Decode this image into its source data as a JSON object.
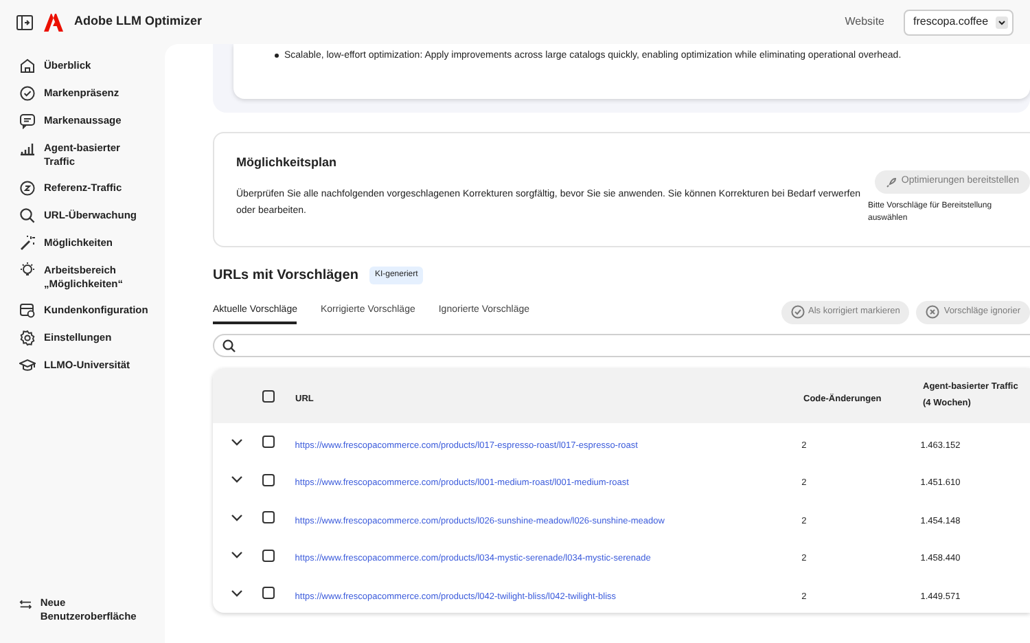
{
  "header": {
    "app_name": "Adobe LLM Optimizer",
    "website_label": "Website",
    "website_value": "frescopa.coffee"
  },
  "sidebar": {
    "items": [
      {
        "label": "Überblick",
        "selected": false
      },
      {
        "label": "Markenpräsenz",
        "selected": false
      },
      {
        "label": "Markenaussage",
        "selected": false
      },
      {
        "label": "Agent-basierter Traffic",
        "selected": false
      },
      {
        "label": "Referenz-Traffic",
        "selected": false
      },
      {
        "label": "URL-Überwachung",
        "selected": false
      },
      {
        "label": "Möglichkeiten",
        "selected": false
      },
      {
        "label": "Arbeitsbereich „Möglichkeiten“",
        "selected": false
      },
      {
        "label": "Kundenkonfiguration",
        "selected": false
      },
      {
        "label": "Einstellungen",
        "selected": false
      },
      {
        "label": "LLMO-Universität",
        "selected": false
      }
    ],
    "footer": "Neue Benutzeroberfläche"
  },
  "summary": {
    "bullet": "Scalable, low-effort optimization: Apply improvements across large catalogs quickly, enabling optimization while eliminating operational overhead."
  },
  "plan": {
    "title": "Möglichkeitsplan",
    "description": "Überprüfen Sie alle nachfolgenden vorgeschlagenen Korrekturen sorgfältig, bevor Sie sie anwenden. Sie können Korrekturen bei Bedarf verwerfen oder bearbeiten.",
    "button": {
      "label": "Optimierungen bereitstellen",
      "disabled": true
    },
    "hint": "Bitte Vorschläge für Bereitstellung auswählen"
  },
  "suggestions": {
    "title": "URLs mit Vorschlägen",
    "badge": "KI-generiert",
    "tabs": [
      {
        "label": "Aktuelle Vorschläge",
        "selected": true
      },
      {
        "label": "Korrigierte Vorschläge",
        "selected": false
      },
      {
        "label": "Ignorierte Vorschläge",
        "selected": false
      }
    ],
    "actions": [
      {
        "label": "Als korrigiert markieren",
        "kind": "mark",
        "disabled": true
      },
      {
        "label": "Vorschläge ignorier",
        "kind": "ignore",
        "disabled": true
      }
    ],
    "table": {
      "select_all_checked": false,
      "columns": [
        "URL",
        "Code-Änderungen",
        "Agent-basierter Traffic (4 Wochen)"
      ],
      "rows": [
        {
          "url": "https://www.frescopacommerce.com/products/l017-espresso-roast/l017-espresso-roast",
          "code_changes": "2",
          "traffic": "1.463.152",
          "checked": false,
          "expanded": false
        },
        {
          "url": "https://www.frescopacommerce.com/products/l001-medium-roast/l001-medium-roast",
          "code_changes": "2",
          "traffic": "1.451.610",
          "checked": false,
          "expanded": false
        },
        {
          "url": "https://www.frescopacommerce.com/products/l026-sunshine-meadow/l026-sunshine-meadow",
          "code_changes": "2",
          "traffic": "1.454.148",
          "checked": false,
          "expanded": false
        },
        {
          "url": "https://www.frescopacommerce.com/products/l034-mystic-serenade/l034-mystic-serenade",
          "code_changes": "2",
          "traffic": "1.458.440",
          "checked": false,
          "expanded": false
        },
        {
          "url": "https://www.frescopacommerce.com/products/l042-twilight-bliss/l042-twilight-bliss",
          "code_changes": "2",
          "traffic": "1.449.571",
          "checked": false,
          "expanded": false
        }
      ]
    }
  }
}
